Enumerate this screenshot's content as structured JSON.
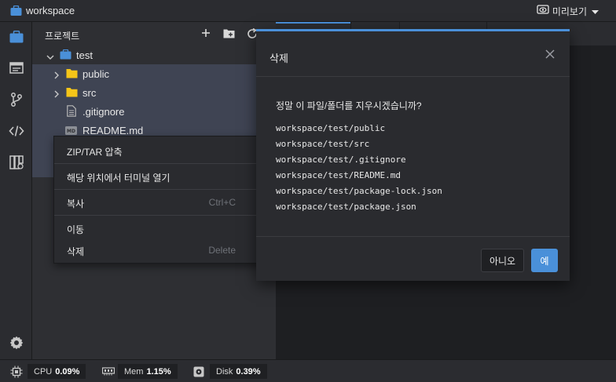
{
  "window": {
    "title": "workspace",
    "preview_label": "미리보기"
  },
  "activity": {
    "items": [
      {
        "name": "explorer-icon",
        "active": true
      },
      {
        "name": "layout-icon"
      },
      {
        "name": "git-branch-icon"
      },
      {
        "name": "code-icon"
      },
      {
        "name": "extensions-icon"
      },
      {
        "name": "settings-icon"
      }
    ]
  },
  "sidebar": {
    "title": "프로젝트",
    "tree": {
      "root": "test",
      "items": [
        {
          "label": "public",
          "type": "folder"
        },
        {
          "label": "src",
          "type": "folder"
        },
        {
          "label": ".gitignore",
          "type": "file"
        },
        {
          "label": "README.md",
          "type": "markdown"
        }
      ]
    }
  },
  "context_menu": {
    "items": [
      {
        "label": "ZIP/TAR 압축",
        "shortcut": ""
      },
      {
        "label": "해당 위치에서 터미널 열기",
        "shortcut": ""
      },
      {
        "label": "복사",
        "shortcut": "Ctrl+C"
      },
      {
        "label": "이동",
        "shortcut": ""
      },
      {
        "label": "삭제",
        "shortcut": "Delete"
      }
    ]
  },
  "dialog": {
    "title": "삭제",
    "message": "정말 이 파일/폴더를 지우시겠습니까?",
    "paths": [
      "workspace/test/public",
      "workspace/test/src",
      "workspace/test/.gitignore",
      "workspace/test/README.md",
      "workspace/test/package-lock.json",
      "workspace/test/package.json"
    ],
    "no_label": "아니오",
    "yes_label": "예"
  },
  "status": {
    "cpu_label": "CPU",
    "cpu_value": "0.09%",
    "mem_label": "Mem",
    "mem_value": "1.15%",
    "disk_label": "Disk",
    "disk_value": "0.39%"
  },
  "colors": {
    "accent": "#4a90d9",
    "folder": "#f5c518",
    "selection": "#3f4453"
  }
}
